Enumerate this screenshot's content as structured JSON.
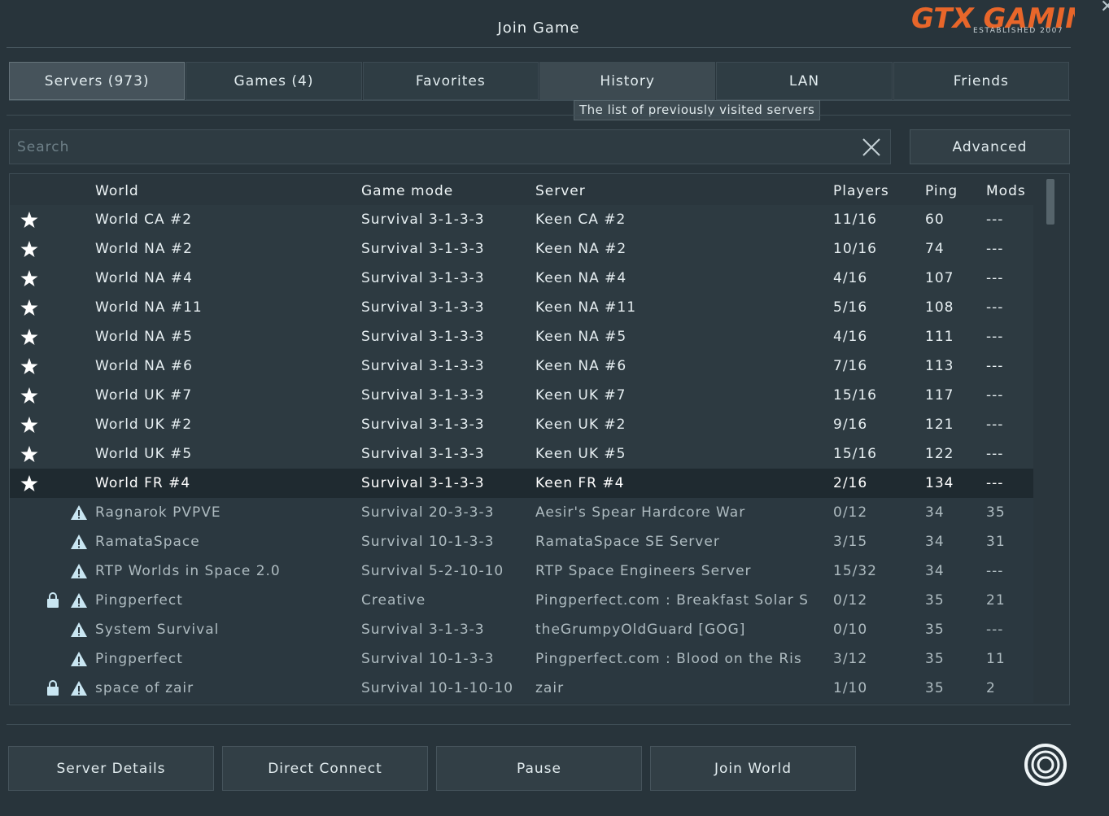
{
  "window": {
    "title": "Join Game",
    "logo_text": "GTX GAMING",
    "logo_subtitle": "ESTABLISHED 2007"
  },
  "tabs": [
    {
      "label": "Servers (973)",
      "state": "active"
    },
    {
      "label": "Games (4)",
      "state": "normal"
    },
    {
      "label": "Favorites",
      "state": "normal"
    },
    {
      "label": "History",
      "state": "hover"
    },
    {
      "label": "LAN",
      "state": "normal"
    },
    {
      "label": "Friends",
      "state": "normal"
    }
  ],
  "tooltip": "The list of previously visited servers",
  "search": {
    "placeholder": "Search",
    "value": ""
  },
  "advanced_label": "Advanced",
  "table": {
    "headers": {
      "world": "World",
      "mode": "Game mode",
      "server": "Server",
      "players": "Players",
      "ping": "Ping",
      "mods": "Mods"
    },
    "rows": [
      {
        "fav": true,
        "lock": false,
        "warn": false,
        "world": "World CA #2",
        "mode": "Survival 3-1-3-3",
        "server": "Keen CA #2",
        "players": "11/16",
        "ping": "60",
        "mods": "---"
      },
      {
        "fav": true,
        "lock": false,
        "warn": false,
        "world": "World NA #2",
        "mode": "Survival 3-1-3-3",
        "server": "Keen NA #2",
        "players": "10/16",
        "ping": "74",
        "mods": "---"
      },
      {
        "fav": true,
        "lock": false,
        "warn": false,
        "world": "World NA #4",
        "mode": "Survival 3-1-3-3",
        "server": "Keen NA #4",
        "players": "4/16",
        "ping": "107",
        "mods": "---"
      },
      {
        "fav": true,
        "lock": false,
        "warn": false,
        "world": "World NA #11",
        "mode": "Survival 3-1-3-3",
        "server": "Keen NA #11",
        "players": "5/16",
        "ping": "108",
        "mods": "---"
      },
      {
        "fav": true,
        "lock": false,
        "warn": false,
        "world": "World NA #5",
        "mode": "Survival 3-1-3-3",
        "server": "Keen NA #5",
        "players": "4/16",
        "ping": "111",
        "mods": "---"
      },
      {
        "fav": true,
        "lock": false,
        "warn": false,
        "world": "World NA #6",
        "mode": "Survival 3-1-3-3",
        "server": "Keen NA #6",
        "players": "7/16",
        "ping": "113",
        "mods": "---"
      },
      {
        "fav": true,
        "lock": false,
        "warn": false,
        "world": "World UK #7",
        "mode": "Survival 3-1-3-3",
        "server": "Keen UK #7",
        "players": "15/16",
        "ping": "117",
        "mods": "---"
      },
      {
        "fav": true,
        "lock": false,
        "warn": false,
        "world": "World UK #2",
        "mode": "Survival 3-1-3-3",
        "server": "Keen UK #2",
        "players": "9/16",
        "ping": "121",
        "mods": "---"
      },
      {
        "fav": true,
        "lock": false,
        "warn": false,
        "world": "World UK #5",
        "mode": "Survival 3-1-3-3",
        "server": "Keen UK #5",
        "players": "15/16",
        "ping": "122",
        "mods": "---"
      },
      {
        "fav": true,
        "lock": false,
        "warn": false,
        "selected": true,
        "world": "World FR #4",
        "mode": "Survival 3-1-3-3",
        "server": "Keen FR #4",
        "players": "2/16",
        "ping": "134",
        "mods": "---"
      },
      {
        "fav": false,
        "lock": false,
        "warn": true,
        "world": "Ragnarok PVPVE",
        "mode": "Survival 20-3-3-3",
        "server": "Aesir's Spear Hardcore War",
        "players": "0/12",
        "ping": "34",
        "mods": "35"
      },
      {
        "fav": false,
        "lock": false,
        "warn": true,
        "world": "RamataSpace",
        "mode": "Survival 10-1-3-3",
        "server": "RamataSpace SE Server",
        "players": "3/15",
        "ping": "34",
        "mods": "31"
      },
      {
        "fav": false,
        "lock": false,
        "warn": true,
        "world": "RTP Worlds in Space 2.0",
        "mode": "Survival 5-2-10-10",
        "server": "RTP Space Engineers Server",
        "players": "15/32",
        "ping": "34",
        "mods": "---"
      },
      {
        "fav": false,
        "lock": true,
        "warn": true,
        "world": "Pingperfect",
        "mode": "Creative",
        "server": "Pingperfect.com : Breakfast Solar S",
        "players": "0/12",
        "ping": "35",
        "mods": "21"
      },
      {
        "fav": false,
        "lock": false,
        "warn": true,
        "world": "System Survival",
        "mode": "Survival 3-1-3-3",
        "server": "theGrumpyOldGuard [GOG]",
        "players": "0/10",
        "ping": "35",
        "mods": "---"
      },
      {
        "fav": false,
        "lock": false,
        "warn": true,
        "world": "Pingperfect",
        "mode": "Survival 10-1-3-3",
        "server": "Pingperfect.com : Blood on the Ris",
        "players": "3/12",
        "ping": "35",
        "mods": "11"
      },
      {
        "fav": false,
        "lock": true,
        "warn": true,
        "world": "space of zair",
        "mode": "Survival 10-1-10-10",
        "server": "zair",
        "players": "1/10",
        "ping": "35",
        "mods": "2"
      }
    ]
  },
  "buttons": {
    "server_details": "Server Details",
    "direct_connect": "Direct Connect",
    "pause": "Pause",
    "join_world": "Join World"
  },
  "colors": {
    "background": "#28343b",
    "accent_logo": "#e8662a",
    "warning_icon": "#c9e6f2"
  }
}
